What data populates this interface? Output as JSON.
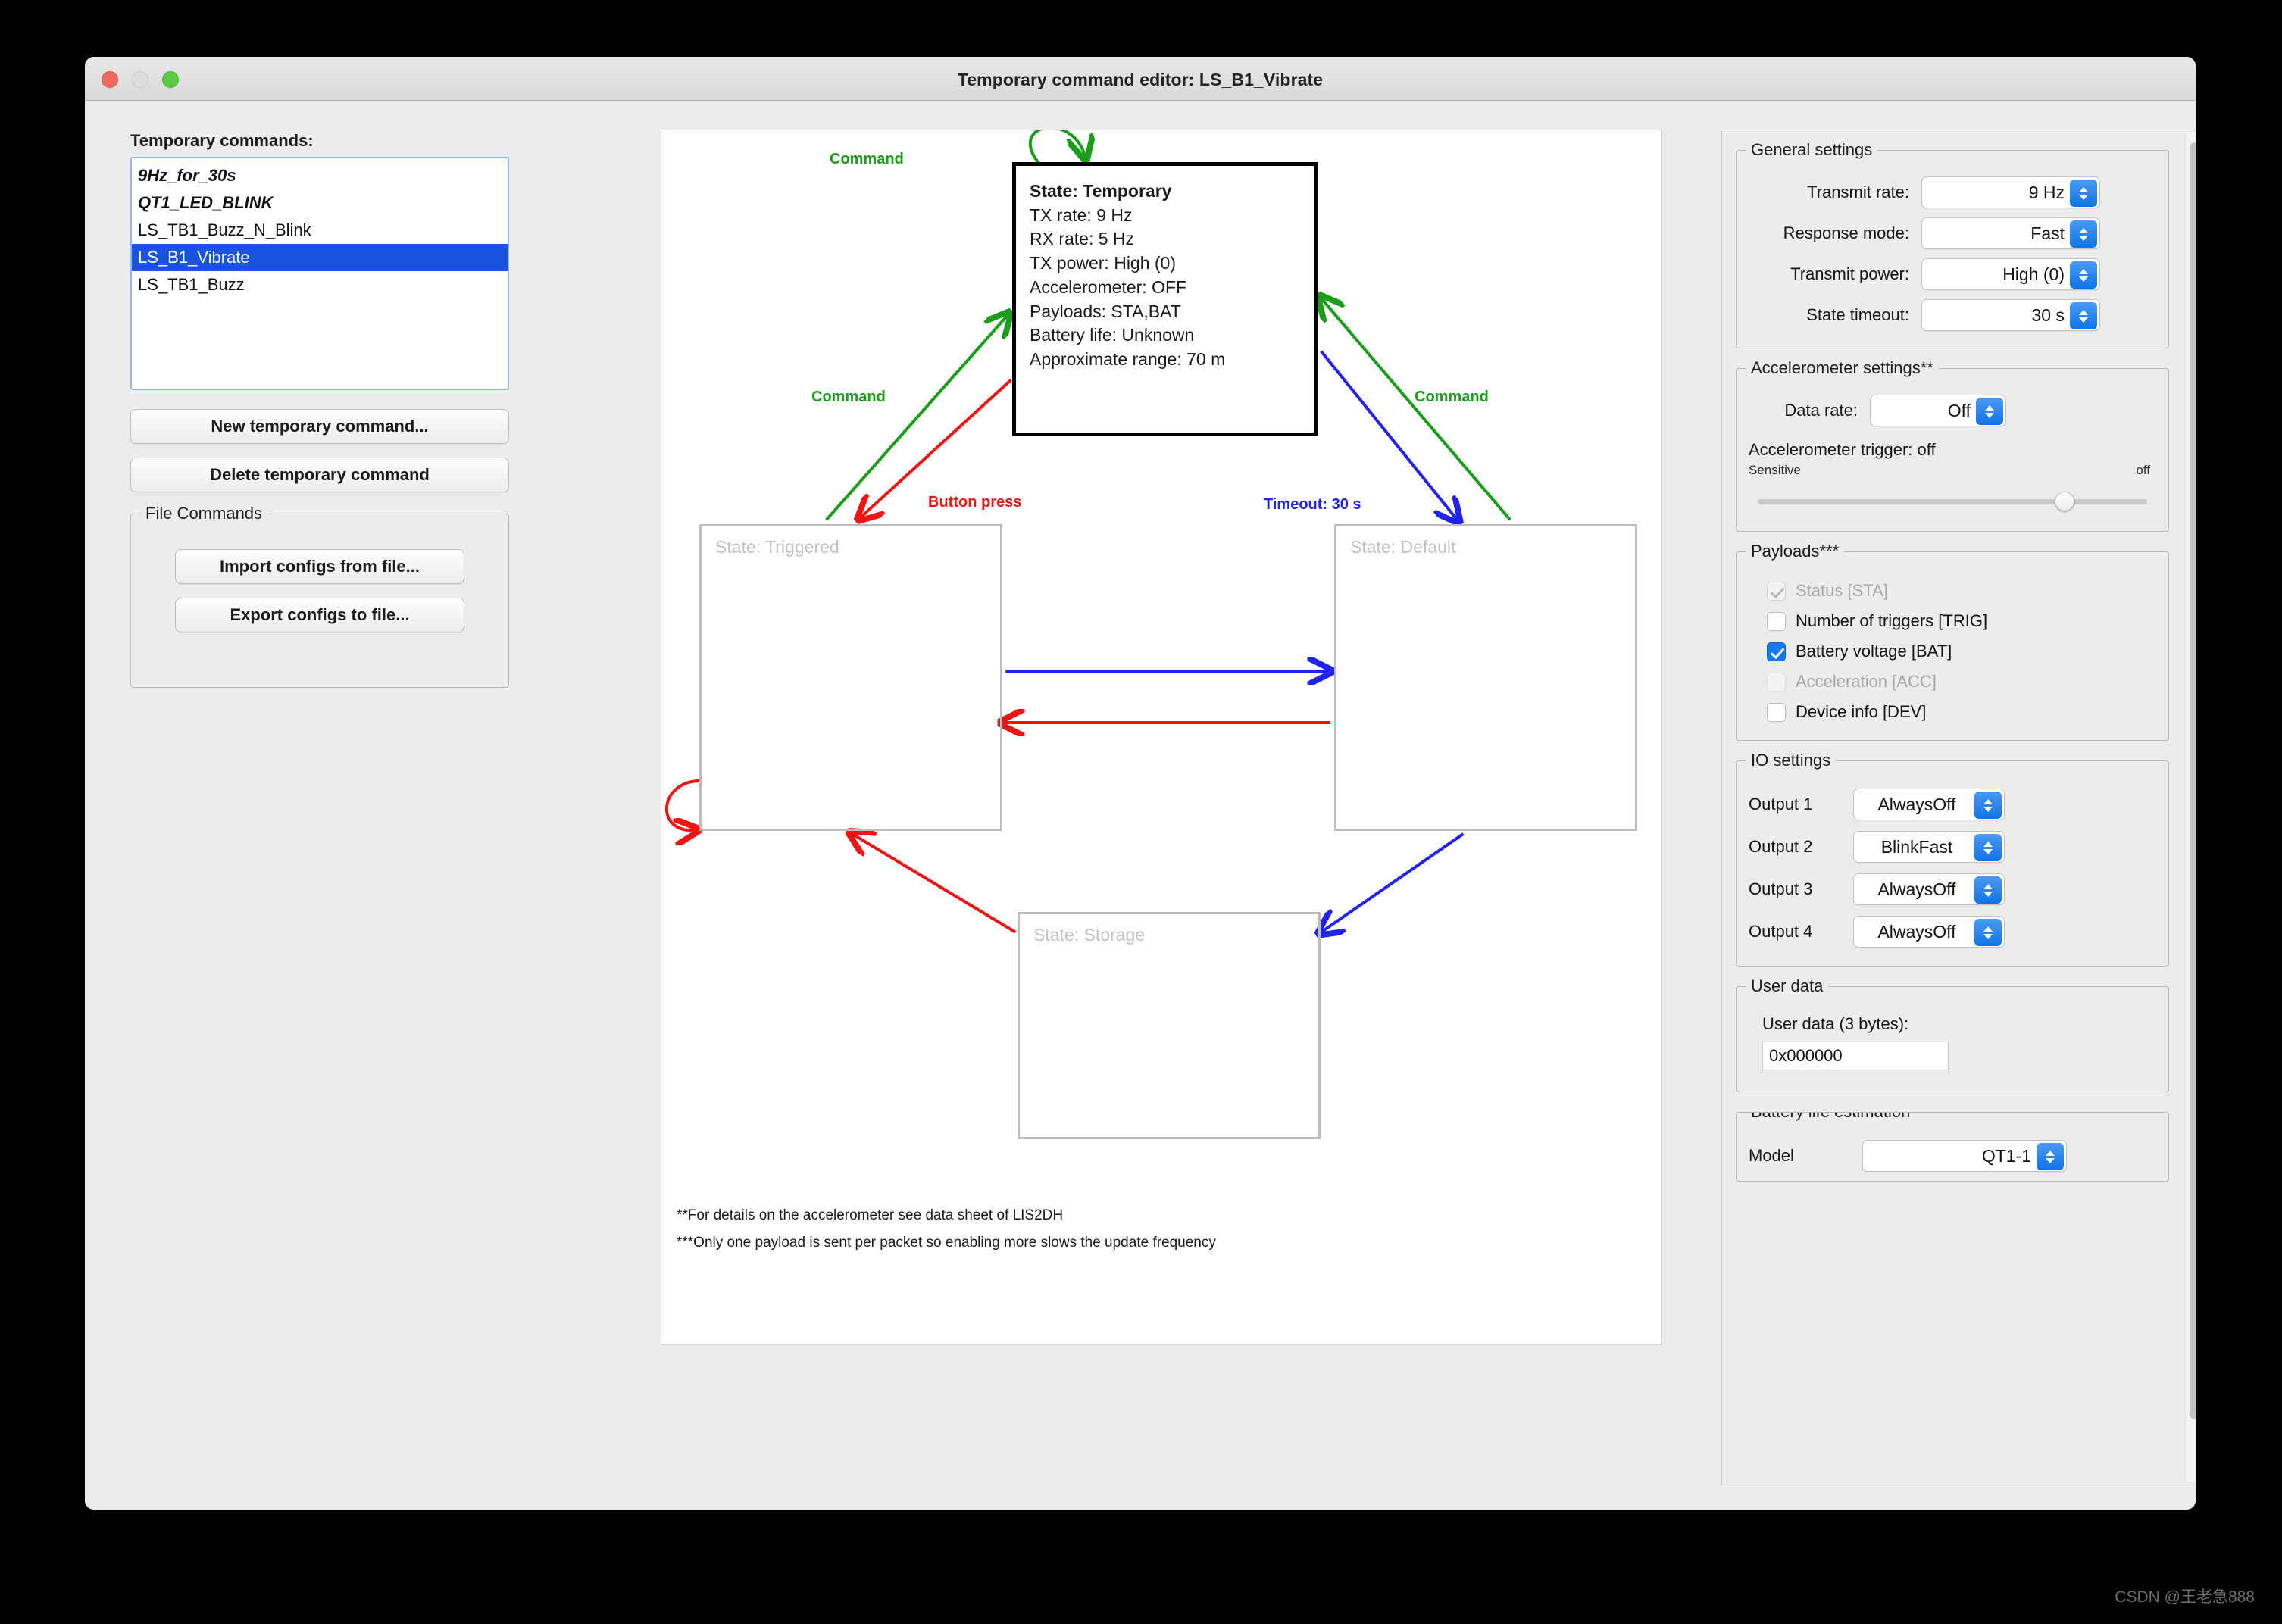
{
  "window": {
    "title": "Temporary command editor:  LS_B1_Vibrate",
    "traffic": {
      "close": "close-button",
      "minimize": "minimize-button",
      "maximize": "maximize-button"
    }
  },
  "left": {
    "list_label": "Temporary commands:",
    "commands": [
      {
        "name": "9Hz_for_30s",
        "style": "italic",
        "selected": false
      },
      {
        "name": "QT1_LED_BLINK",
        "style": "italic",
        "selected": false
      },
      {
        "name": "LS_TB1_Buzz_N_Blink",
        "style": "normal",
        "selected": false
      },
      {
        "name": "LS_B1_Vibrate",
        "style": "normal",
        "selected": true
      },
      {
        "name": "LS_TB1_Buzz",
        "style": "normal",
        "selected": false
      }
    ],
    "new_button": "New temporary command...",
    "delete_button": "Delete temporary command",
    "file_commands": {
      "title": "File Commands",
      "import_button": "Import configs from file...",
      "export_button": "Export configs to file..."
    }
  },
  "diagram": {
    "temporary_state": {
      "title": "State: Temporary",
      "lines": [
        "TX rate: 9 Hz",
        "RX rate: 5 Hz",
        "TX power: High (0)",
        "Accelerometer: OFF",
        "Payloads: STA,BAT",
        "Battery life: Unknown",
        "Approximate range: 70 m"
      ]
    },
    "states": [
      {
        "id": "triggered",
        "label": "State: Triggered"
      },
      {
        "id": "default",
        "label": "State: Default"
      },
      {
        "id": "storage",
        "label": "State: Storage"
      }
    ],
    "edge_labels": [
      {
        "id": "self-loop-command",
        "text": "Command",
        "color": "green"
      },
      {
        "id": "triggered-to-temporary-command",
        "text": "Command",
        "color": "green"
      },
      {
        "id": "temporary-to-triggered-button-press",
        "text": "Button press",
        "color": "red"
      },
      {
        "id": "temporary-to-default-timeout",
        "text": "Timeout: 30 s",
        "color": "blue"
      },
      {
        "id": "default-to-temporary-command",
        "text": "Command",
        "color": "green"
      }
    ],
    "colors": {
      "green": "#1a9e1a",
      "red": "#f01414",
      "blue": "#2222ee",
      "state_border": "#bdbdbd"
    },
    "footnotes": [
      "**For details on the accelerometer see data sheet of LIS2DH",
      "***Only one payload is sent per packet so enabling more slows the update frequency"
    ]
  },
  "settings": {
    "general": {
      "title": "General settings",
      "rows": [
        {
          "label": "Transmit rate:",
          "value": "9 Hz"
        },
        {
          "label": "Response mode:",
          "value": "Fast"
        },
        {
          "label": "Transmit power:",
          "value": "High (0)"
        },
        {
          "label": "State timeout:",
          "value": "30 s"
        }
      ]
    },
    "accelerometer": {
      "title": "Accelerometer settings**",
      "data_rate_label": "Data rate:",
      "data_rate_value": "Off",
      "trigger_label": "Accelerometer trigger: off",
      "scale_min": "Sensitive",
      "scale_max": "off"
    },
    "payloads": {
      "title": "Payloads***",
      "items": [
        {
          "label": "Status [STA]",
          "checked": true,
          "enabled": false
        },
        {
          "label": "Number of triggers [TRIG]",
          "checked": false,
          "enabled": true
        },
        {
          "label": "Battery voltage [BAT]",
          "checked": true,
          "enabled": true
        },
        {
          "label": "Acceleration [ACC]",
          "checked": false,
          "enabled": false
        },
        {
          "label": "Device info [DEV]",
          "checked": false,
          "enabled": true
        }
      ]
    },
    "io": {
      "title": "IO settings",
      "rows": [
        {
          "label": "Output 1",
          "value": "AlwaysOff"
        },
        {
          "label": "Output 2",
          "value": "BlinkFast"
        },
        {
          "label": "Output 3",
          "value": "AlwaysOff"
        },
        {
          "label": "Output 4",
          "value": "AlwaysOff"
        }
      ]
    },
    "user_data": {
      "title": "User data",
      "field_label": "User data (3 bytes):",
      "value": "0x000000"
    },
    "battery": {
      "title": "Battery life estimation",
      "model_label": "Model",
      "model_value": "QT1-1"
    },
    "accent_color": "#1579f0"
  },
  "watermark": "CSDN @王老急888"
}
